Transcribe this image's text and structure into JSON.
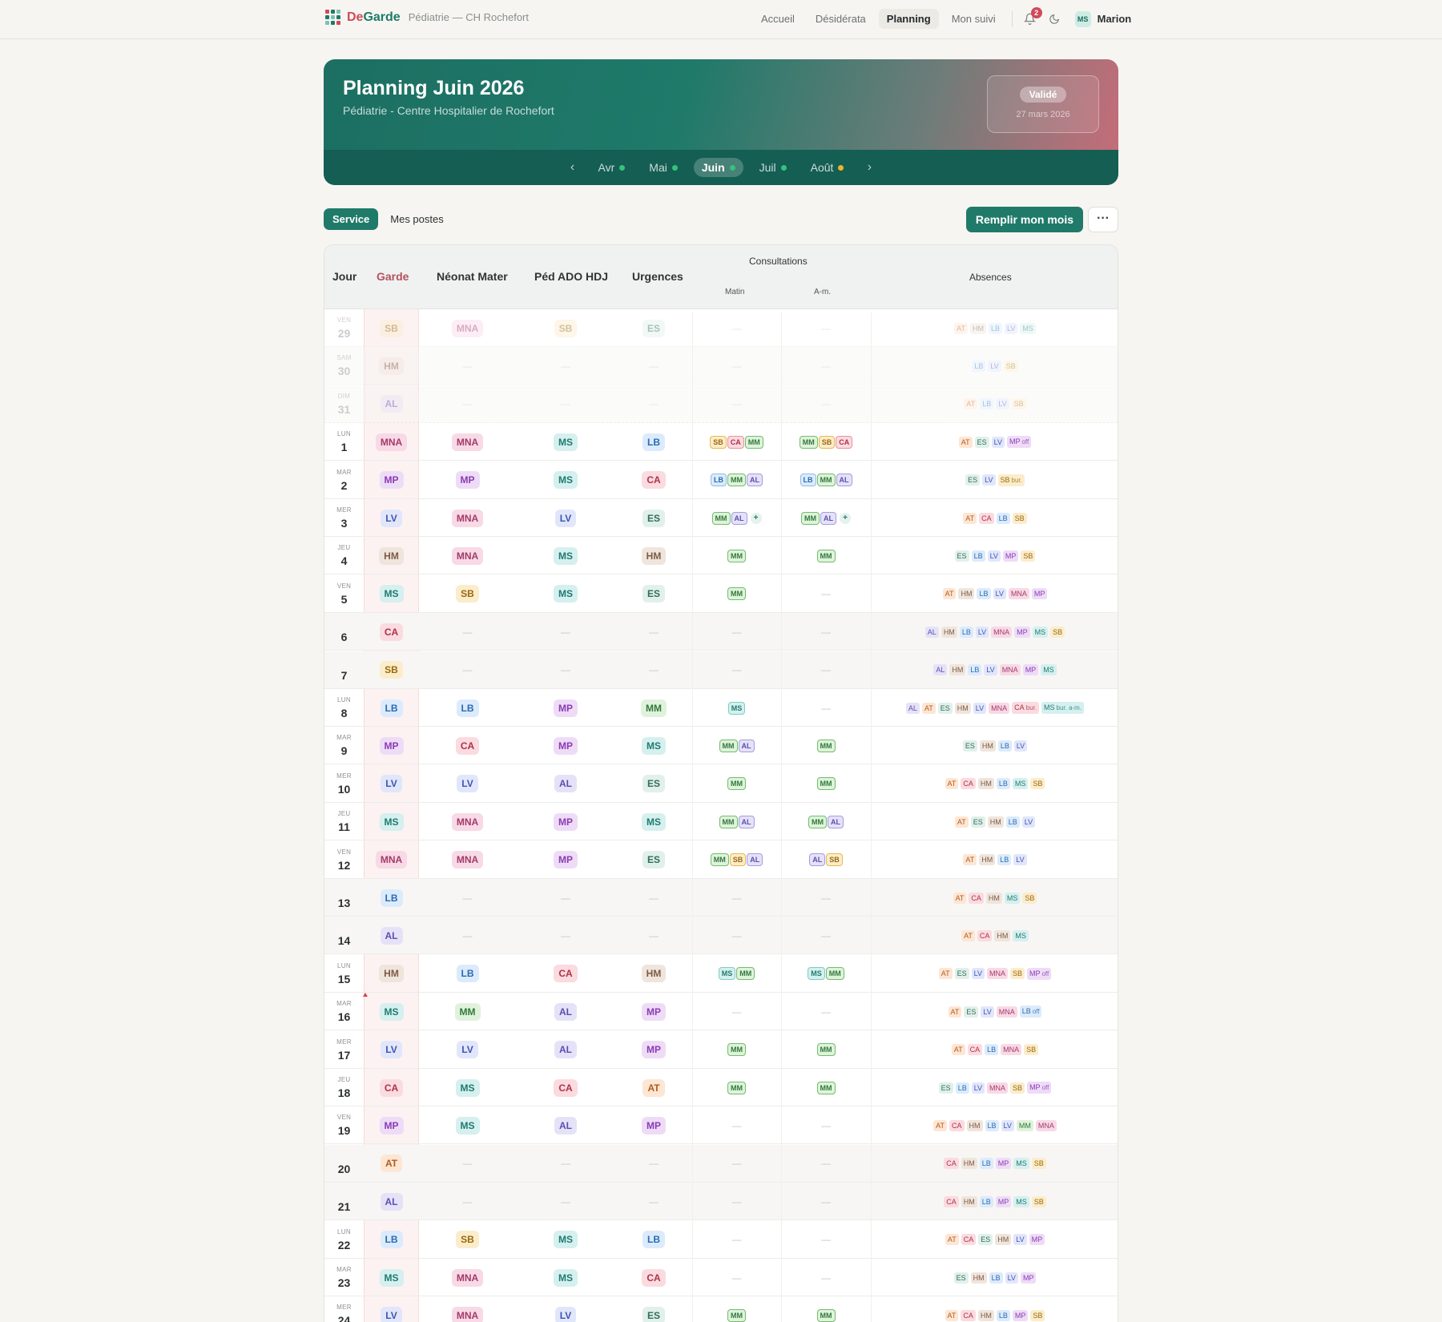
{
  "app": {
    "brand_de": "De",
    "brand_garde": "Garde",
    "subtitle": "Pédiatrie — CH Rochefort"
  },
  "nav": {
    "items": [
      "Accueil",
      "Désidérata",
      "Planning",
      "Mon suivi"
    ],
    "active": "Planning",
    "notif_count": "2",
    "user_initials": "MS",
    "user_name": "Marion"
  },
  "hero": {
    "title": "Planning Juin 2026",
    "subtitle": "Pédiatrie - Centre Hospitalier de Rochefort",
    "status": "Validé",
    "status_date": "27 mars 2026"
  },
  "months": [
    {
      "label": "Avr",
      "dot": "#35c27d",
      "active": false
    },
    {
      "label": "Mai",
      "dot": "#35c27d",
      "active": false
    },
    {
      "label": "Juin",
      "dot": "#35c27d",
      "active": true
    },
    {
      "label": "Juil",
      "dot": "#35c27d",
      "active": false
    },
    {
      "label": "Août",
      "dot": "#f0b429",
      "active": false
    }
  ],
  "toolbar": {
    "service": "Service",
    "mes_postes": "Mes postes",
    "fill": "Remplir mon mois",
    "more": "···"
  },
  "table": {
    "headers": {
      "jour": "Jour",
      "garde": "Garde",
      "neonat": "Néonat Mater",
      "ped": "Péd ADO HDJ",
      "urg": "Urgences",
      "consult": "Consultations",
      "matin": "Matin",
      "am": "A-m.",
      "absences": "Absences"
    },
    "rows": [
      {
        "dow": "VEN",
        "day": "29",
        "prev": true,
        "garde": "SB",
        "neonat": "MNA",
        "ped": "SB",
        "urg": "ES",
        "matin": [],
        "am": [],
        "abs": [
          "AT",
          "HM",
          "LB",
          "LV",
          "MS"
        ]
      },
      {
        "dow": "SAM",
        "day": "30",
        "prev": true,
        "weekend": true,
        "garde": "HM",
        "neonat": "",
        "ped": "",
        "urg": "",
        "matin": [],
        "am": [],
        "abs": [
          "LB",
          "LV",
          "SB"
        ]
      },
      {
        "dow": "DIM",
        "day": "31",
        "prev": true,
        "weekend": true,
        "last_prev": true,
        "garde": "AL",
        "neonat": "",
        "ped": "",
        "urg": "",
        "matin": [],
        "am": [],
        "abs": [
          "AT",
          "LB",
          "LV",
          "SB"
        ]
      },
      {
        "dow": "LUN",
        "day": "1",
        "garde": "MNA",
        "neonat": "MNA",
        "ped": "MS",
        "urg": "LB",
        "matin": [
          "SB",
          "CA",
          "MM"
        ],
        "am": [
          "MM",
          "SB",
          "CA"
        ],
        "abs": [
          "AT",
          "ES",
          "LV",
          "MP|off"
        ]
      },
      {
        "dow": "MAR",
        "day": "2",
        "garde": "MP",
        "neonat": "MP",
        "ped": "MS",
        "urg": "CA",
        "matin": [
          "LB",
          "MM",
          "AL"
        ],
        "am": [
          "LB",
          "MM",
          "AL"
        ],
        "abs": [
          "ES",
          "LV",
          "SB|bur."
        ]
      },
      {
        "dow": "MER",
        "day": "3",
        "garde": "LV",
        "neonat": "MNA",
        "ped": "LV",
        "urg": "ES",
        "matin": [
          "MM",
          "AL",
          "+"
        ],
        "am": [
          "MM",
          "AL",
          "+"
        ],
        "abs": [
          "AT",
          "CA",
          "LB",
          "SB"
        ]
      },
      {
        "dow": "JEU",
        "day": "4",
        "garde": "HM",
        "neonat": "MNA",
        "ped": "MS",
        "urg": "HM",
        "matin": [
          "MM"
        ],
        "am": [
          "MM"
        ],
        "abs": [
          "ES",
          "LB",
          "LV",
          "MP",
          "SB"
        ]
      },
      {
        "dow": "VEN",
        "day": "5",
        "garde": "MS",
        "neonat": "SB",
        "ped": "MS",
        "urg": "ES",
        "matin": [
          "MM"
        ],
        "am": [],
        "abs": [
          "AT",
          "HM",
          "LB",
          "LV",
          "MNA",
          "MP"
        ]
      },
      {
        "dow": "",
        "day": "6",
        "weekend": true,
        "garde": "CA",
        "neonat": "",
        "ped": "",
        "urg": "",
        "matin": [],
        "am": [],
        "abs": [
          "AL",
          "HM",
          "LB",
          "LV",
          "MNA",
          "MP",
          "MS",
          "SB"
        ]
      },
      {
        "dow": "",
        "day": "7",
        "weekend": true,
        "garde": "SB",
        "neonat": "",
        "ped": "",
        "urg": "",
        "matin": [],
        "am": [],
        "abs": [
          "AL",
          "HM",
          "LB",
          "LV",
          "MNA",
          "MP",
          "MS"
        ]
      },
      {
        "dow": "LUN",
        "day": "8",
        "garde": "LB",
        "neonat": "LB",
        "ped": "MP",
        "urg": "MM",
        "matin": [
          "MS"
        ],
        "am": [],
        "abs": [
          "AL",
          "AT",
          "ES",
          "HM",
          "LV",
          "MNA",
          "CA|bur.",
          "MS|bur. a-m."
        ]
      },
      {
        "dow": "MAR",
        "day": "9",
        "garde": "MP",
        "neonat": "CA",
        "ped": "MP",
        "urg": "MS",
        "matin": [
          "MM",
          "AL"
        ],
        "am": [
          "MM"
        ],
        "abs": [
          "ES",
          "HM",
          "LB",
          "LV"
        ]
      },
      {
        "dow": "MER",
        "day": "10",
        "garde": "LV",
        "neonat": "LV",
        "ped": "AL",
        "urg": "ES",
        "matin": [
          "MM"
        ],
        "am": [
          "MM"
        ],
        "abs": [
          "AT",
          "CA",
          "HM",
          "LB",
          "MS",
          "SB"
        ]
      },
      {
        "dow": "JEU",
        "day": "11",
        "garde": "MS",
        "neonat": "MNA",
        "ped": "MP",
        "urg": "MS",
        "matin": [
          "MM",
          "AL"
        ],
        "am": [
          "MM",
          "AL"
        ],
        "abs": [
          "AT",
          "ES",
          "HM",
          "LB",
          "LV"
        ]
      },
      {
        "dow": "VEN",
        "day": "12",
        "garde": "MNA",
        "neonat": "MNA",
        "ped": "MP",
        "urg": "ES",
        "matin": [
          "MM",
          "SB",
          "AL"
        ],
        "am": [
          "AL",
          "SB"
        ],
        "abs": [
          "AT",
          "HM",
          "LB",
          "LV"
        ]
      },
      {
        "dow": "",
        "day": "13",
        "weekend": true,
        "garde": "LB",
        "neonat": "",
        "ped": "",
        "urg": "",
        "matin": [],
        "am": [],
        "abs": [
          "AT",
          "CA",
          "HM",
          "MS",
          "SB"
        ]
      },
      {
        "dow": "",
        "day": "14",
        "weekend": true,
        "garde": "AL",
        "neonat": "",
        "ped": "",
        "urg": "",
        "matin": [],
        "am": [],
        "abs": [
          "AT",
          "CA",
          "HM",
          "MS"
        ]
      },
      {
        "dow": "LUN",
        "day": "15",
        "garde": "HM",
        "neonat": "LB",
        "ped": "CA",
        "urg": "HM",
        "matin": [
          "MS",
          "MM"
        ],
        "am": [
          "MS",
          "MM"
        ],
        "abs": [
          "AT",
          "ES",
          "LV",
          "MNA",
          "SB",
          "MP|off"
        ]
      },
      {
        "dow": "MAR",
        "day": "16",
        "garde": "MS",
        "neonat": "MM",
        "ped": "AL",
        "urg": "MP",
        "matin": [],
        "am": [],
        "abs": [
          "AT",
          "ES",
          "LV",
          "MNA",
          "LB|off"
        ],
        "marker": true
      },
      {
        "dow": "MER",
        "day": "17",
        "garde": "LV",
        "neonat": "LV",
        "ped": "AL",
        "urg": "MP",
        "matin": [
          "MM"
        ],
        "am": [
          "MM"
        ],
        "abs": [
          "AT",
          "CA",
          "LB",
          "MNA",
          "SB"
        ]
      },
      {
        "dow": "JEU",
        "day": "18",
        "garde": "CA",
        "neonat": "MS",
        "ped": "CA",
        "urg": "AT",
        "matin": [
          "MM"
        ],
        "am": [
          "MM"
        ],
        "abs": [
          "ES",
          "LB",
          "LV",
          "MNA",
          "SB",
          "MP|off"
        ]
      },
      {
        "dow": "VEN",
        "day": "19",
        "garde": "MP",
        "neonat": "MS",
        "ped": "AL",
        "urg": "MP",
        "matin": [],
        "am": [],
        "abs": [
          "AT",
          "CA",
          "HM",
          "LB",
          "LV",
          "MM",
          "MNA"
        ]
      },
      {
        "dow": "",
        "day": "20",
        "weekend": true,
        "garde": "AT",
        "neonat": "",
        "ped": "",
        "urg": "",
        "matin": [],
        "am": [],
        "abs": [
          "CA",
          "HM",
          "LB",
          "MP",
          "MS",
          "SB"
        ]
      },
      {
        "dow": "",
        "day": "21",
        "weekend": true,
        "garde": "AL",
        "neonat": "",
        "ped": "",
        "urg": "",
        "matin": [],
        "am": [],
        "abs": [
          "CA",
          "HM",
          "LB",
          "MP",
          "MS",
          "SB"
        ]
      },
      {
        "dow": "LUN",
        "day": "22",
        "garde": "LB",
        "neonat": "SB",
        "ped": "MS",
        "urg": "LB",
        "matin": [],
        "am": [],
        "abs": [
          "AT",
          "CA",
          "ES",
          "HM",
          "LV",
          "MP"
        ]
      },
      {
        "dow": "MAR",
        "day": "23",
        "garde": "MS",
        "neonat": "MNA",
        "ped": "MS",
        "urg": "CA",
        "matin": [],
        "am": [],
        "abs": [
          "ES",
          "HM",
          "LB",
          "LV",
          "MP"
        ]
      },
      {
        "dow": "MER",
        "day": "24",
        "garde": "LV",
        "neonat": "MNA",
        "ped": "LV",
        "urg": "ES",
        "matin": [
          "MM"
        ],
        "am": [
          "MM"
        ],
        "abs": [
          "AT",
          "CA",
          "HM",
          "LB",
          "MP",
          "SB"
        ]
      }
    ]
  },
  "colors": {
    "SB": {
      "bg": "#fbeccb",
      "fg": "#9a6a0c",
      "bd": "#e8b94a"
    },
    "MNA": {
      "bg": "#f8d9e6",
      "fg": "#a43a6a",
      "bd": "#e38fb3"
    },
    "ES": {
      "bg": "#e1f0ea",
      "fg": "#2f6e59",
      "bd": "#8cc6b0"
    },
    "HM": {
      "bg": "#efe5dc",
      "fg": "#7c5b45",
      "bd": "#c9ab94"
    },
    "AL": {
      "bg": "#e5e2f8",
      "fg": "#5a4fb0",
      "bd": "#a59ce0"
    },
    "MP": {
      "bg": "#eedcf7",
      "fg": "#8a3bb3",
      "bd": "#c79ae3"
    },
    "MS": {
      "bg": "#d5f0ee",
      "fg": "#1f7a72",
      "bd": "#7ecdc5"
    },
    "LB": {
      "bg": "#dcebfb",
      "fg": "#2a6bb3",
      "bd": "#8fbbe8"
    },
    "CA": {
      "bg": "#fadbe0",
      "fg": "#b03147",
      "bd": "#e892a1"
    },
    "LV": {
      "bg": "#e1e6fa",
      "fg": "#3d55b8",
      "bd": "#a1b0e8"
    },
    "MM": {
      "bg": "#e0f2dc",
      "fg": "#2f7a3a",
      "bd": "#6fbf6a"
    },
    "AT": {
      "bg": "#fde6d4",
      "fg": "#b35a1c",
      "bd": "#eeb184"
    }
  }
}
